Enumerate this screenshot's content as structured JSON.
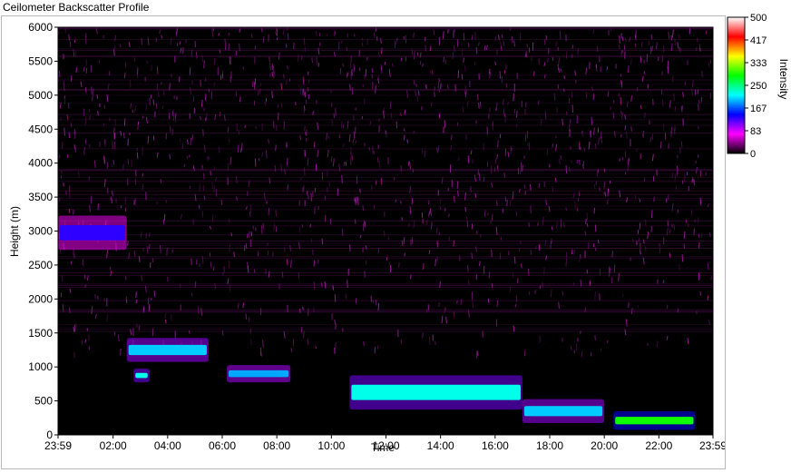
{
  "window": {
    "title": "Ceilometer Backscatter Profile"
  },
  "chart_data": {
    "type": "heatmap",
    "title": "",
    "xlabel": "Time",
    "ylabel": "Height (m)",
    "xlim": [
      "23:59",
      "23:59"
    ],
    "ylim": [
      0,
      6000
    ],
    "x_ticks": [
      "23:59",
      "02:00",
      "04:00",
      "06:00",
      "08:00",
      "10:00",
      "12:00",
      "14:00",
      "16:00",
      "18:00",
      "20:00",
      "22:00",
      "23:59"
    ],
    "y_ticks": [
      0,
      500,
      1000,
      1500,
      2000,
      2500,
      3000,
      3500,
      4000,
      4500,
      5000,
      5500,
      6000
    ],
    "grid": false,
    "colorbar": {
      "label": "Intensity",
      "range": [
        0,
        500
      ],
      "ticks": [
        "500",
        "417",
        "333",
        "250",
        "167",
        "83",
        "0"
      ],
      "colors": [
        "#000000",
        "#ff00ff",
        "#0000ff",
        "#00ffff",
        "#00ff00",
        "#ffff00",
        "#ff0000",
        "#ffffff"
      ]
    },
    "layers": [
      {
        "x_start": "23:59",
        "x_end": "02:30",
        "height_min": 2750,
        "height_max": 3200,
        "intensity": 130
      },
      {
        "x_start": "02:30",
        "x_end": "05:30",
        "height_min": 1100,
        "height_max": 1400,
        "intensity": 200
      },
      {
        "x_start": "02:45",
        "x_end": "03:20",
        "height_min": 800,
        "height_max": 950,
        "intensity": 220
      },
      {
        "x_start": "06:10",
        "x_end": "08:30",
        "height_min": 800,
        "height_max": 1000,
        "intensity": 190
      },
      {
        "x_start": "10:40",
        "x_end": "17:00",
        "height_min": 400,
        "height_max": 850,
        "intensity": 220
      },
      {
        "x_start": "17:00",
        "x_end": "20:00",
        "height_min": 200,
        "height_max": 500,
        "intensity": 200
      },
      {
        "x_start": "20:20",
        "x_end": "23:20",
        "height_min": 100,
        "height_max": 320,
        "intensity": 290
      }
    ]
  }
}
